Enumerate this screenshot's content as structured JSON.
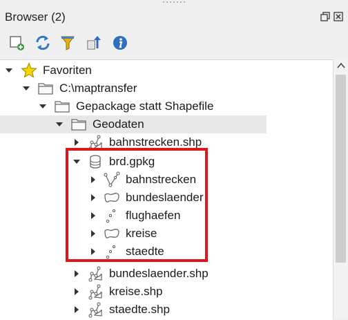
{
  "panel": {
    "title": "Browser (2)"
  },
  "toolbar": {
    "items": [
      {
        "name": "add-layer-icon"
      },
      {
        "name": "refresh-icon"
      },
      {
        "name": "filter-icon"
      },
      {
        "name": "collapse-all-icon"
      },
      {
        "name": "info-icon"
      }
    ]
  },
  "tree": {
    "favoriten": "Favoriten",
    "maptransfer": "C:\\maptransfer",
    "gepackage": "Gepackage statt Shapefile",
    "geodaten": "Geodaten",
    "bahnstrecken_shp": "bahnstrecken.shp",
    "brd_gpkg": "brd.gpkg",
    "bahnstrecken": "bahnstrecken",
    "bundeslaender": "bundeslaender",
    "flughaefen": "flughaefen",
    "kreise": "kreise",
    "staedte": "staedte",
    "bundeslaender_shp": "bundeslaender.shp",
    "kreise_shp": "kreise.shp",
    "staedte_shp": "staedte.shp"
  },
  "colors": {
    "highlight": "#e0141b",
    "star": "#f5d800",
    "refresh": "#2f78c4",
    "filter": "#e8b400"
  }
}
